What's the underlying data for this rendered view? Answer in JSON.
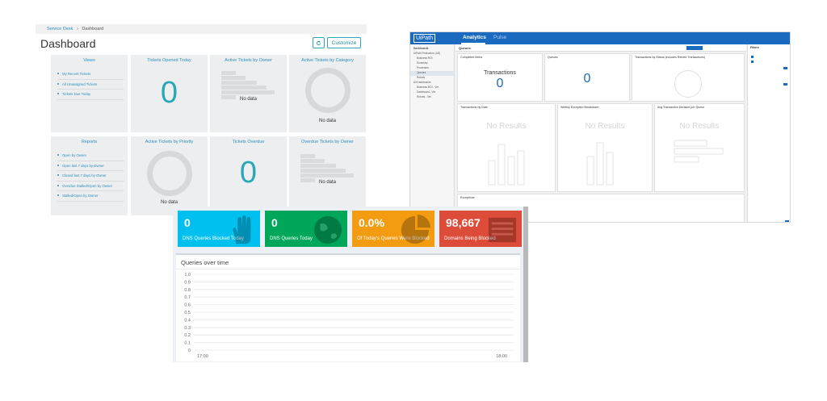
{
  "service_desk": {
    "breadcrumb": {
      "root": "Service Desk",
      "separator": "›",
      "current": "Dashboard"
    },
    "title": "Dashboard",
    "customize_label": "Customize",
    "views": {
      "title": "Views",
      "items": [
        "My Recent Tickets",
        "All Unassigned Tickets",
        "Tickets Due Today"
      ]
    },
    "reports": {
      "title": "Reports",
      "items": [
        "Open by Owner",
        "Open last 7 days by Owner",
        "Closed last 7 days by Owner",
        "Overdue Stalled/Open by Owner",
        "Stalled/Open by Owner"
      ]
    },
    "tickets_opened_today": {
      "title": "Tickets Opened Today",
      "value": "0"
    },
    "active_by_owner": {
      "title": "Active Tickets by Owner",
      "empty": "No data"
    },
    "active_by_category": {
      "title": "Active Tickets by Category",
      "empty": "No data"
    },
    "active_by_priority": {
      "title": "Active Tickets by Priority",
      "empty": "No data"
    },
    "tickets_overdue": {
      "title": "Tickets Overdue",
      "value": "0"
    },
    "overdue_by_owner": {
      "title": "Overdue Tickets by Owner",
      "empty": "No data"
    },
    "accent": "#2aa8b8"
  },
  "uipath": {
    "logo": "UiPath",
    "tabs": [
      "Analytics",
      "Pulse"
    ],
    "sidebar_title": "Dashboards",
    "sidebar_items": [
      "UiPath Production (1/8)",
      "Business ROI",
      "Summary",
      "Processes",
      "Queues",
      "Robots",
      "All Dashboards",
      "Business ROI - Ver.",
      "Dashboard - Ver.",
      "Robots - Ver."
    ],
    "breadcrumb": "Queues",
    "tiles": {
      "completed_items": {
        "title": "Completed Items",
        "label": "Transactions",
        "value": "0"
      },
      "queues": {
        "title": "Queues",
        "value": "0"
      },
      "transactions_by_status": {
        "title": "Transactions by Status (includes Retried Transactions)"
      },
      "transactions_by_date": {
        "title": "Transactions by Date",
        "empty": "No Results"
      },
      "weekly_exception": {
        "title": "Weekly Exception Breakdown",
        "empty": "No Results"
      },
      "avg_duration": {
        "title": "Avg Transaction Duration per Queue",
        "empty": "No Results"
      },
      "exceptions": {
        "title": "Exceptions"
      }
    },
    "filters_title": "Filters",
    "brand": "#1a6ac0"
  },
  "pihole": {
    "boxes": [
      {
        "value": "0",
        "label": "DNS Queries Blocked Today",
        "color": "#00c0ef",
        "icon": "hand-icon"
      },
      {
        "value": "0",
        "label": "DNS Queries Today",
        "color": "#00a65a",
        "icon": "globe-icon"
      },
      {
        "value": "0.0%",
        "label": "Of Today's Queries Were Blocked",
        "color": "#f39c12",
        "icon": "pie-icon"
      },
      {
        "value": "98,667",
        "label": "Domains Being Blocked",
        "color": "#dd4b39",
        "icon": "list-icon"
      }
    ],
    "chart_data": {
      "type": "line",
      "title": "Queries over time",
      "ylim": [
        0,
        1.0
      ],
      "y_ticks": [
        "1.0",
        "0.9",
        "0.8",
        "0.7",
        "0.6",
        "0.5",
        "0.4",
        "0.3",
        "0.2",
        "0.1",
        "0"
      ],
      "x_ticks": [
        "17:00",
        "18:00"
      ],
      "series": [],
      "grid": true
    }
  }
}
